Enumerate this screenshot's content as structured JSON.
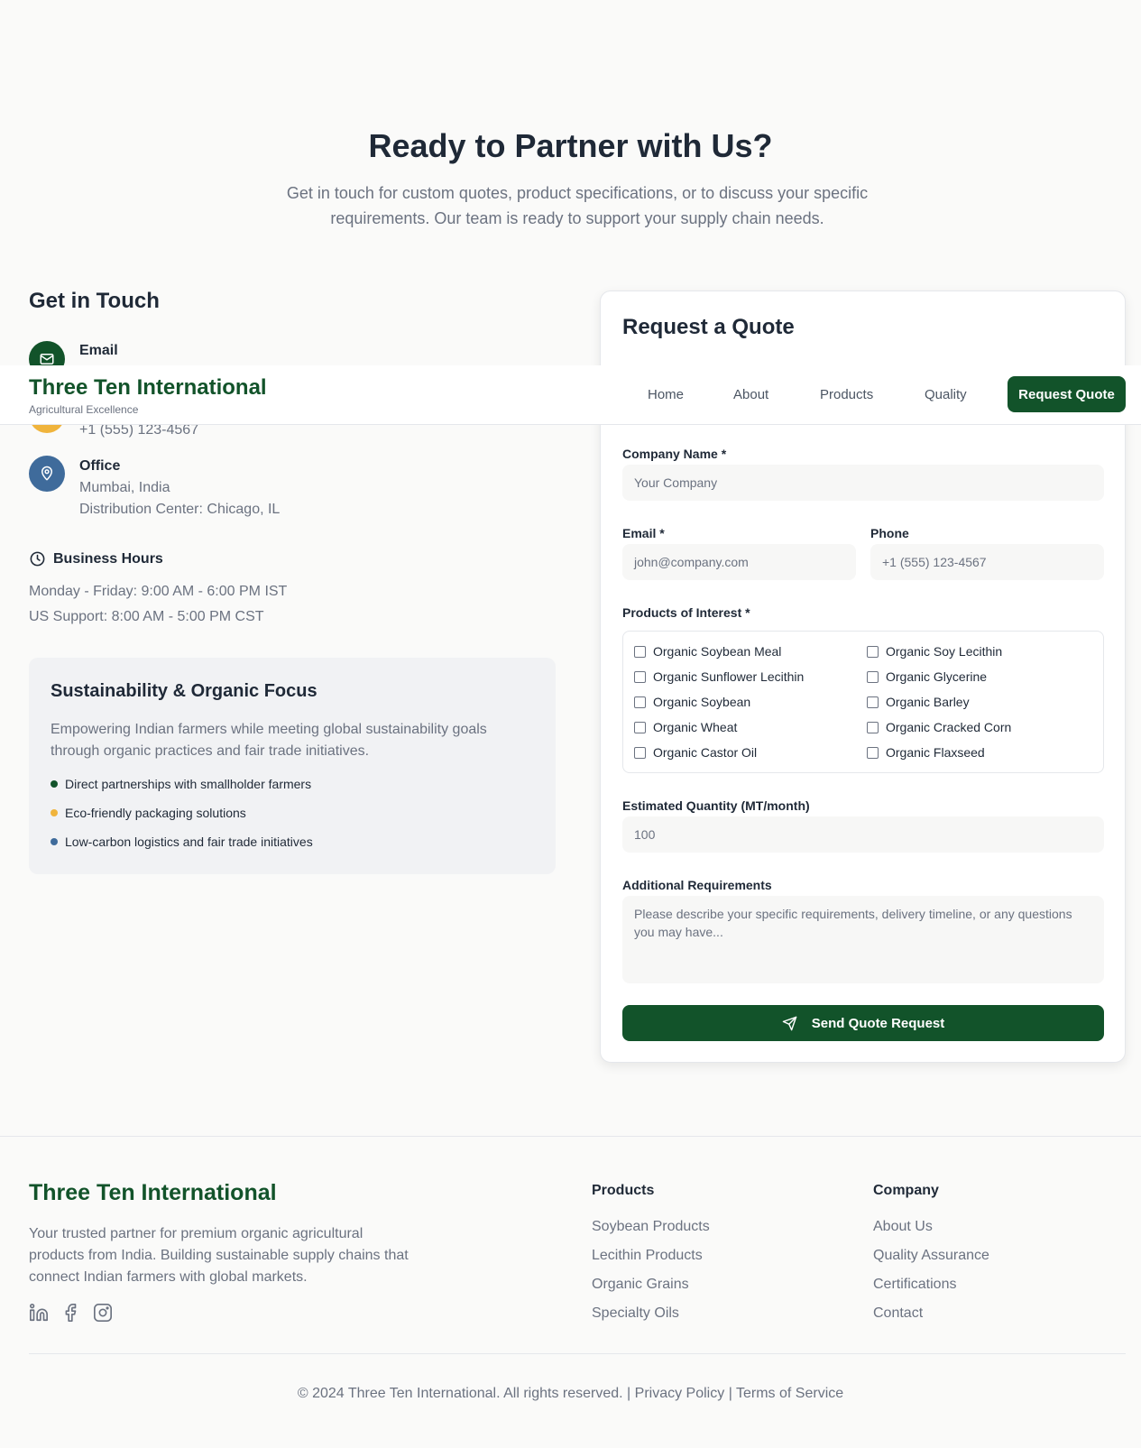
{
  "hero": {
    "title": "Ready to Partner with Us?",
    "subtitle": "Get in touch for custom quotes, product specifications, or to discuss your specific requirements. Our team is ready to support your supply chain needs."
  },
  "contact": {
    "heading": "Get in Touch",
    "email_label": "Email",
    "phone_value": "+1 (555) 123-4567",
    "office_label": "Office",
    "office_line1": "Mumbai, India",
    "office_line2": "Distribution Center: Chicago, IL"
  },
  "hours": {
    "title": "Business Hours",
    "line1": "Monday - Friday: 9:00 AM - 6:00 PM IST",
    "line2": "US Support: 8:00 AM - 5:00 PM CST"
  },
  "sustainability": {
    "title": "Sustainability & Organic Focus",
    "description": "Empowering Indian farmers while meeting global sustainability goals through organic practices and fair trade initiatives.",
    "items": [
      "Direct partnerships with smallholder farmers",
      "Eco-friendly packaging solutions",
      "Low-carbon logistics and fair trade initiatives"
    ]
  },
  "quote_form": {
    "title": "Request a Quote",
    "company_label": "Company Name *",
    "company_placeholder": "Your Company",
    "email_label": "Email *",
    "email_placeholder": "john@company.com",
    "phone_label": "Phone",
    "phone_placeholder": "+1 (555) 123-4567",
    "products_label": "Products of Interest *",
    "products": [
      "Organic Soybean Meal",
      "Organic Soy Lecithin",
      "Organic Sunflower Lecithin",
      "Organic Glycerine",
      "Organic Soybean",
      "Organic Barley",
      "Organic Wheat",
      "Organic Cracked Corn",
      "Organic Castor Oil",
      "Organic Flaxseed"
    ],
    "quantity_label": "Estimated Quantity (MT/month)",
    "quantity_placeholder": "100",
    "requirements_label": "Additional Requirements",
    "requirements_placeholder": "Please describe your specific requirements, delivery timeline, or any questions you may have...",
    "submit_label": "Send Quote Request"
  },
  "nav": {
    "brand": "Three Ten International",
    "tagline": "Agricultural Excellence",
    "links": [
      "Home",
      "About",
      "Products",
      "Quality"
    ],
    "cta": "Request Quote"
  },
  "footer": {
    "brand": "Three Ten International",
    "description": "Your trusted partner for premium organic agricultural products from India. Building sustainable supply chains that connect Indian farmers with global markets.",
    "products_title": "Products",
    "products_links": [
      "Soybean Products",
      "Lecithin Products",
      "Organic Grains",
      "Specialty Oils"
    ],
    "company_title": "Company",
    "company_links": [
      "About Us",
      "Quality Assurance",
      "Certifications",
      "Contact"
    ],
    "copyright": "© 2024 Three Ten International. All rights reserved.",
    "privacy": "Privacy Policy",
    "terms": "Terms of Service",
    "separator": "|"
  },
  "colors": {
    "brand_green": "#12532a",
    "accent_yellow": "#f0b43c",
    "accent_blue": "#3f6b9b"
  },
  "icons": {
    "email": "mail-icon",
    "office": "map-pin-icon",
    "hours": "clock-icon",
    "send": "send-icon",
    "social": [
      "linkedin-icon",
      "facebook-icon",
      "instagram-icon"
    ]
  }
}
